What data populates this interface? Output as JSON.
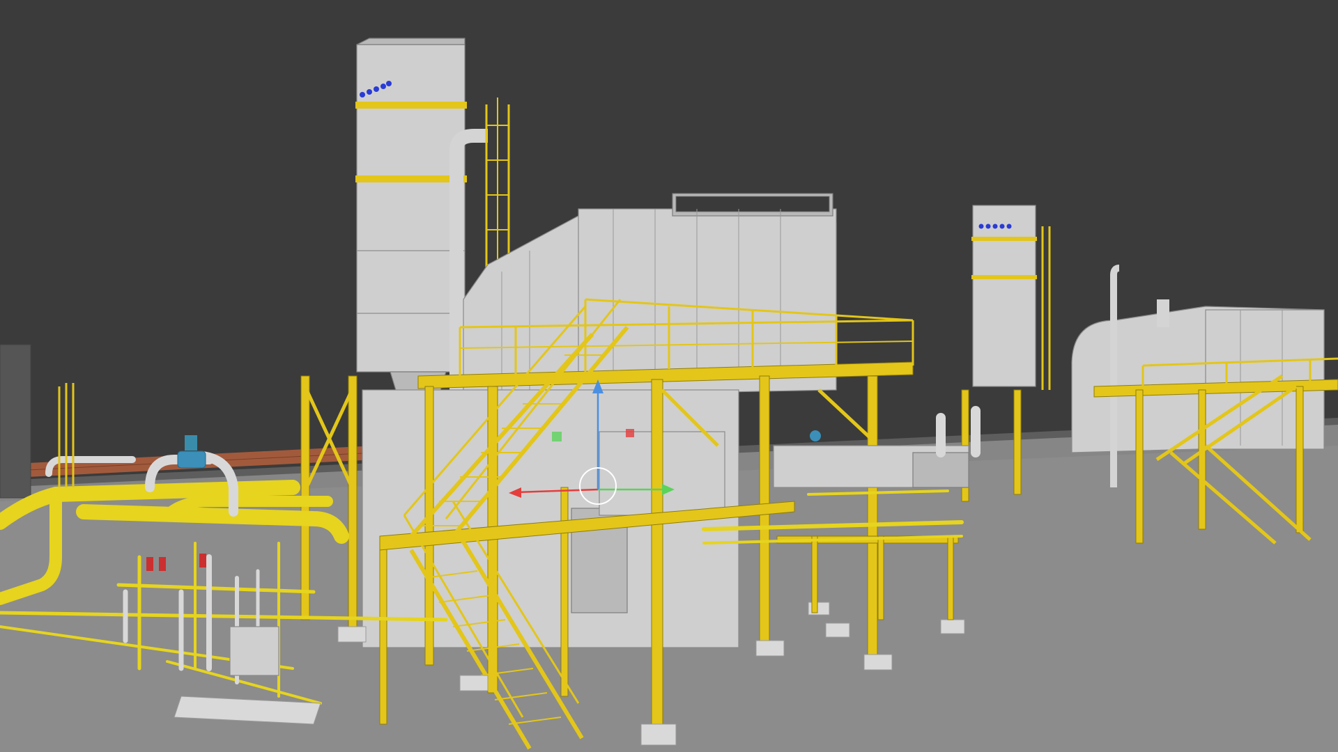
{
  "viewport": {
    "background_color": "#3b3b3b",
    "ground_color": "#8c8c8c",
    "steel_color": "#e3c619",
    "equipment_color": "#cfcfcf",
    "wall_color": "#a25a3c"
  },
  "gizmo": {
    "axis_colors": {
      "x": "#e53c3c",
      "y": "#5bd25b",
      "z": "#4a90e2"
    },
    "icon": "transform-gizmo-icon"
  }
}
